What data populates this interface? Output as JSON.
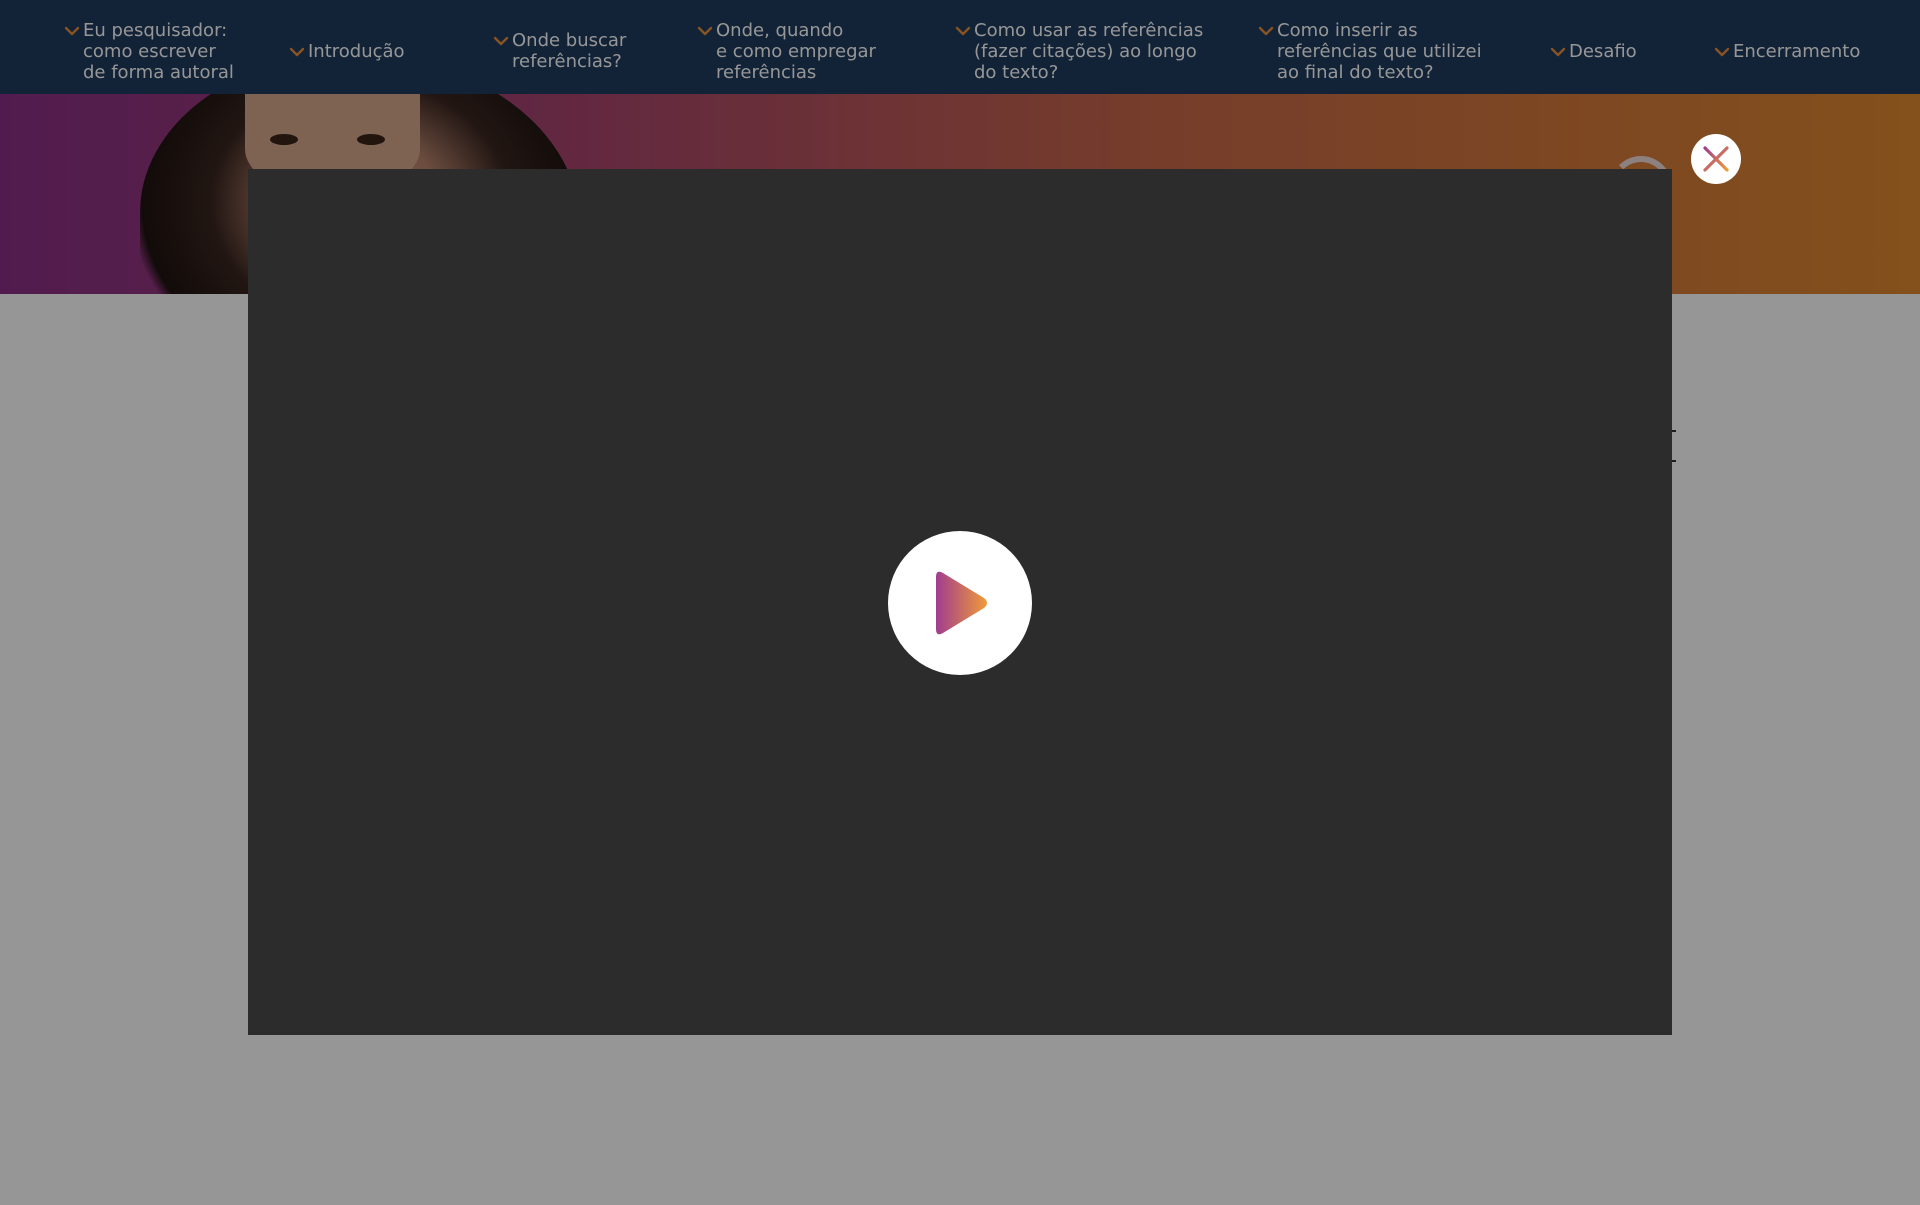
{
  "nav": {
    "items": [
      {
        "label": "Eu pesquisador:\ncomo escrever\nde forma autoral"
      },
      {
        "label": "Introdução"
      },
      {
        "label": "Onde buscar\nreferências?"
      },
      {
        "label": "Onde, quando\ne como empregar\nreferências"
      },
      {
        "label": "Como usar as referências\n(fazer citações) ao longo\ndo texto?"
      },
      {
        "label": "Como inserir as\nreferências que utilizei\nao final do texto?"
      },
      {
        "label": "Desafio"
      },
      {
        "label": "Encerramento"
      }
    ],
    "icon": "chevron-down-icon",
    "chevron_color": "#e8903a",
    "background": "#1f3b5e"
  },
  "hero": {
    "gradient": [
      "#8a2f86",
      "#c9684a",
      "#e0892f"
    ]
  },
  "modal": {
    "play_icon": "play-icon",
    "close_icon": "close-icon",
    "accent_gradient": [
      "#a03d8e",
      "#f09a3a"
    ],
    "player_background": "#2c2c2c"
  }
}
